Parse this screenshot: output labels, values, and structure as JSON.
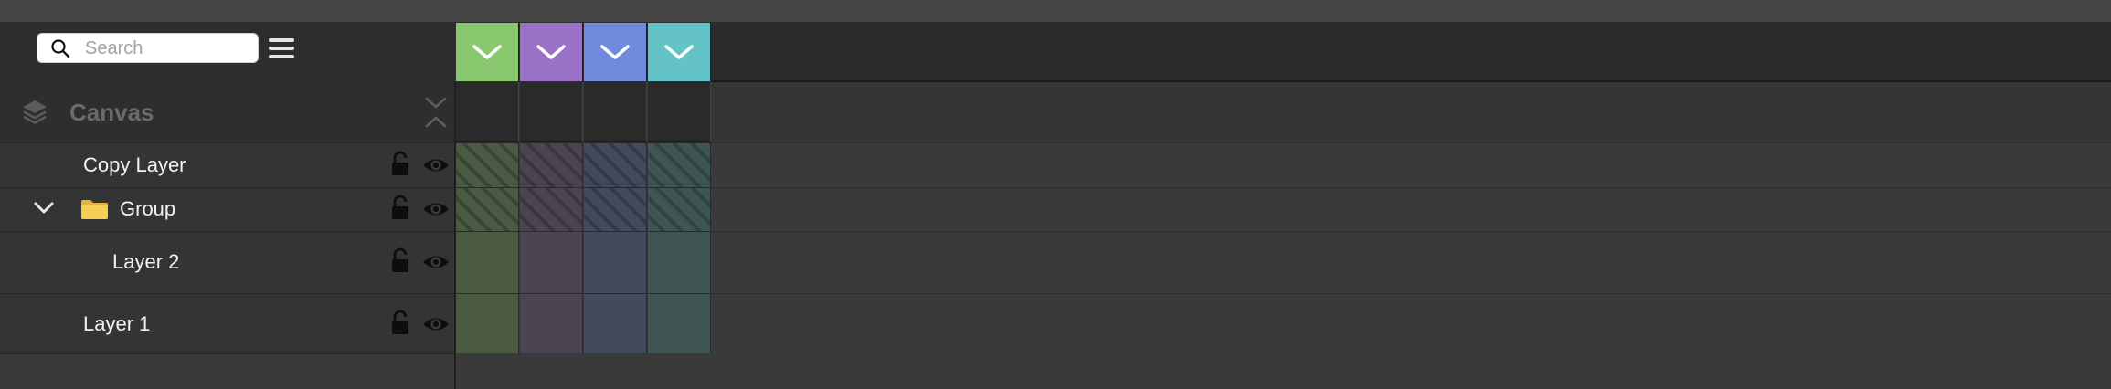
{
  "search": {
    "placeholder": "Search",
    "value": ""
  },
  "canvas": {
    "label": "Canvas"
  },
  "columns": [
    {
      "color": "#89c86e"
    },
    {
      "color": "#9a73c8"
    },
    {
      "color": "#6f8bdc"
    },
    {
      "color": "#63c3c6"
    }
  ],
  "cell_colors": [
    "#4a5a43",
    "#4a4453",
    "#434a5c",
    "#3f5554"
  ],
  "layers": [
    {
      "label": "Copy Layer",
      "hatched": true
    },
    {
      "label": "Group",
      "hatched": true,
      "expanded": true,
      "icon": "folder-icon"
    },
    {
      "label": "Layer 2",
      "hatched": false
    },
    {
      "label": "Layer 1",
      "hatched": false
    }
  ],
  "icons": {
    "search": "search-icon",
    "menu": "menu-icon",
    "layers": "layers-icon",
    "collapse": "collapse-icon",
    "lock": "lock-icon",
    "visibility": "eye-icon",
    "disclosure": "chevron-down-icon",
    "folder": "folder-icon",
    "column": "chevron-down-icon"
  }
}
